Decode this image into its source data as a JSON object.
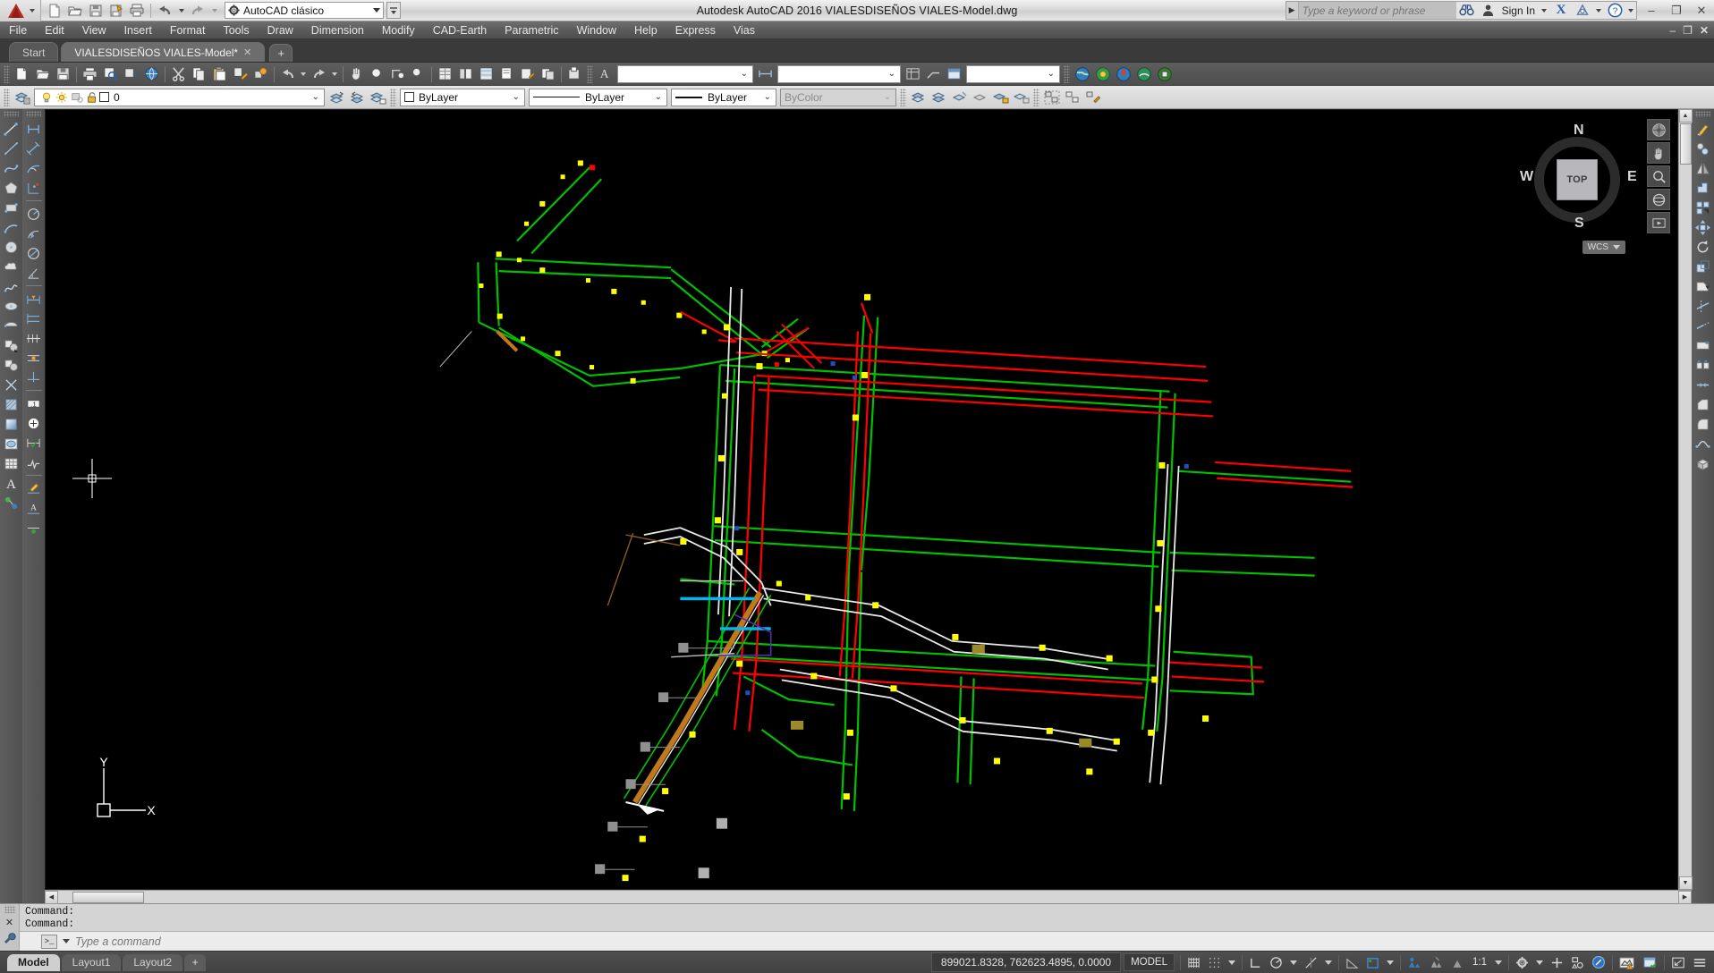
{
  "window": {
    "title": "Autodesk AutoCAD 2016    VIALESDISEÑOS VIALES-Model.dwg",
    "minimize": "–",
    "restore": "❐",
    "close": "✕"
  },
  "quick_access": {
    "workspace_label": "AutoCAD clásico",
    "buttons": [
      {
        "name": "new-file-button",
        "icon": "new-file-icon"
      },
      {
        "name": "open-file-button",
        "icon": "open-folder-icon"
      },
      {
        "name": "save-button",
        "icon": "floppy-disk-icon"
      },
      {
        "name": "save-as-button",
        "icon": "save-as-icon"
      },
      {
        "name": "plot-button",
        "icon": "printer-icon"
      },
      {
        "name": "undo-button",
        "icon": "undo-arrow-icon"
      },
      {
        "name": "redo-button",
        "icon": "redo-arrow-icon"
      }
    ]
  },
  "infocenter": {
    "placeholder": "Type a keyword or phrase",
    "sign_in": "Sign In",
    "search_icon": "binoculars-icon",
    "user_icon": "person-icon",
    "exchange_icon": "autodesk-exchange-icon",
    "help_icon": "question-mark-icon"
  },
  "menubar": {
    "items": [
      {
        "label": "File",
        "name": "menu-file"
      },
      {
        "label": "Edit",
        "name": "menu-edit"
      },
      {
        "label": "View",
        "name": "menu-view"
      },
      {
        "label": "Insert",
        "name": "menu-insert"
      },
      {
        "label": "Format",
        "name": "menu-format"
      },
      {
        "label": "Tools",
        "name": "menu-tools"
      },
      {
        "label": "Draw",
        "name": "menu-draw"
      },
      {
        "label": "Dimension",
        "name": "menu-dimension"
      },
      {
        "label": "Modify",
        "name": "menu-modify"
      },
      {
        "label": "CAD-Earth",
        "name": "menu-cad-earth"
      },
      {
        "label": "Parametric",
        "name": "menu-parametric"
      },
      {
        "label": "Window",
        "name": "menu-window"
      },
      {
        "label": "Help",
        "name": "menu-help"
      },
      {
        "label": "Express",
        "name": "menu-express"
      },
      {
        "label": "Vias",
        "name": "menu-vias"
      }
    ],
    "doc_minimize": "–",
    "doc_restore": "❐",
    "doc_close": "✕"
  },
  "file_tabs": {
    "tabs": [
      {
        "label": "Start",
        "active": false,
        "closable": false
      },
      {
        "label": "VIALESDISEÑOS VIALES-Model*",
        "active": true,
        "closable": true
      }
    ],
    "close_glyph": "✕",
    "new_tab": "+"
  },
  "layer_toolbar": {
    "layer_properties_icon": "layer-properties-manager-icon",
    "current_layer": "0",
    "state_icons": [
      "lightbulb-on-icon",
      "sun-freeze-icon",
      "freeze-viewport-icon",
      "unlock-padlock-icon",
      "layer-color-swatch-icon"
    ],
    "dropdown_caret": "⌄",
    "trailing_icons": [
      "make-object-layer-current-icon",
      "layer-previous-icon",
      "layer-states-icon"
    ]
  },
  "properties_toolbar": {
    "color": {
      "label": "ByLayer",
      "name": "color-control",
      "swatch": "#ffffff"
    },
    "linetype": {
      "label": "ByLayer",
      "name": "linetype-control"
    },
    "lineweight": {
      "label": "ByLayer",
      "name": "lineweight-control"
    },
    "plotstyle": {
      "label": "ByColor",
      "name": "plotstyle-control",
      "disabled": true
    },
    "caret": "⌄"
  },
  "style_toolbar": {
    "text_style": "",
    "dim_style": "",
    "table_style": "",
    "caret": "⌄"
  },
  "draw_toolbar": {
    "name": "draw-toolbar",
    "buttons": [
      "line-icon",
      "construction-line-icon",
      "polyline-icon",
      "polygon-icon",
      "rectangle-icon",
      "arc-icon",
      "circle-icon",
      "revision-cloud-icon",
      "spline-icon",
      "ellipse-icon",
      "ellipse-arc-icon",
      "insert-block-icon",
      "make-block-icon",
      "point-icon",
      "hatch-icon",
      "gradient-icon",
      "region-icon",
      "table-icon",
      "multiline-text-icon",
      "add-selected-icon"
    ]
  },
  "dimension_toolbar": {
    "name": "dimension-toolbar",
    "buttons": [
      "linear-dimension-icon",
      "aligned-dimension-icon",
      "arc-length-dimension-icon",
      "ordinate-dimension-icon",
      "radius-dimension-icon",
      "jogged-dimension-icon",
      "diameter-dimension-icon",
      "angular-dimension-icon",
      "quick-dimension-icon",
      "baseline-dimension-icon",
      "continue-dimension-icon",
      "dimension-space-icon",
      "dimension-break-icon",
      "tolerance-icon",
      "center-mark-icon",
      "inspection-icon",
      "jogged-linear-icon",
      "dim-edit-icon",
      "dim-text-edit-icon",
      "dim-update-icon"
    ]
  },
  "modify_toolbar": {
    "name": "modify-toolbar",
    "buttons": [
      "erase-icon",
      "copy-icon",
      "mirror-icon",
      "offset-icon",
      "array-icon",
      "move-icon",
      "rotate-icon",
      "scale-icon",
      "stretch-icon",
      "trim-icon",
      "extend-icon",
      "break-icon",
      "break-at-point-icon",
      "join-icon",
      "chamfer-icon",
      "fillet-icon",
      "blend-curves-icon",
      "explode-icon"
    ]
  },
  "viewcube": {
    "face": "TOP",
    "north": "N",
    "south": "S",
    "east": "E",
    "west": "W",
    "ucs_label": "WCS",
    "ucs_caret": "▼"
  },
  "navbar": {
    "buttons": [
      "full-navigation-wheel-icon",
      "pan-icon",
      "zoom-extents-icon",
      "orbit-icon",
      "showmotion-icon"
    ]
  },
  "ucs_icon": {
    "x_label": "X",
    "y_label": "Y"
  },
  "command_window": {
    "history": [
      "Command:",
      "Command:"
    ],
    "placeholder": "Type a command",
    "prompt_glyph": ">_",
    "close_glyph": "✕",
    "tools_icon": "wrench-icon"
  },
  "status_bar": {
    "layout_tabs": [
      {
        "label": "Model",
        "active": true
      },
      {
        "label": "Layout1",
        "active": false
      },
      {
        "label": "Layout2",
        "active": false
      }
    ],
    "add_layout": "+",
    "coordinates": "899021.8328, 762623.4895, 0.0000",
    "space_button": "MODEL",
    "annotation_scale": "1:1",
    "toggles": [
      {
        "name": "grid-display-toggle",
        "icon": "grid-icon"
      },
      {
        "name": "snap-mode-toggle",
        "icon": "snap-dots-icon"
      },
      {
        "name": "ortho-mode-toggle",
        "icon": "ortho-corner-icon"
      },
      {
        "name": "polar-tracking-toggle",
        "icon": "polar-angle-icon"
      },
      {
        "name": "object-snap-toggle",
        "icon": "osnap-icon"
      },
      {
        "name": "osnap-tracking-toggle",
        "icon": "otrack-icon"
      },
      {
        "name": "lineweight-toggle",
        "icon": "lineweight-icon"
      },
      {
        "name": "transparency-toggle",
        "icon": "transparency-icon"
      },
      {
        "name": "selection-cycling-toggle",
        "icon": "selection-cycling-icon"
      },
      {
        "name": "annotation-visibility-toggle",
        "icon": "annotation-visibility-icon"
      },
      {
        "name": "autoscale-toggle",
        "icon": "autoscale-icon"
      },
      {
        "name": "workspace-switching-button",
        "icon": "gear-icon"
      },
      {
        "name": "hardware-acceleration-button",
        "icon": "plus-icon"
      },
      {
        "name": "isolate-objects-button",
        "icon": "isolate-objects-icon"
      },
      {
        "name": "clean-screen-button",
        "icon": "clean-screen-icon"
      },
      {
        "name": "graphics-performance-button",
        "icon": "graphics-performance-icon"
      },
      {
        "name": "units-button",
        "icon": "units-icon"
      },
      {
        "name": "expand-status-bar-button",
        "icon": "hamburger-icon"
      }
    ]
  },
  "drawing": {
    "description": "Road network design plan (diseños viales) in model space",
    "colors": {
      "background": "#000000",
      "centerline_green": "#00c000",
      "node_yellow": "#ffff00",
      "road_red": "#ff0000",
      "edge_white": "#e8e8e8",
      "highlight_cyan": "#00b7ef",
      "corridor_orange": "#c07818",
      "purple": "#5b2bb0",
      "marker_gray": "#909090"
    }
  }
}
